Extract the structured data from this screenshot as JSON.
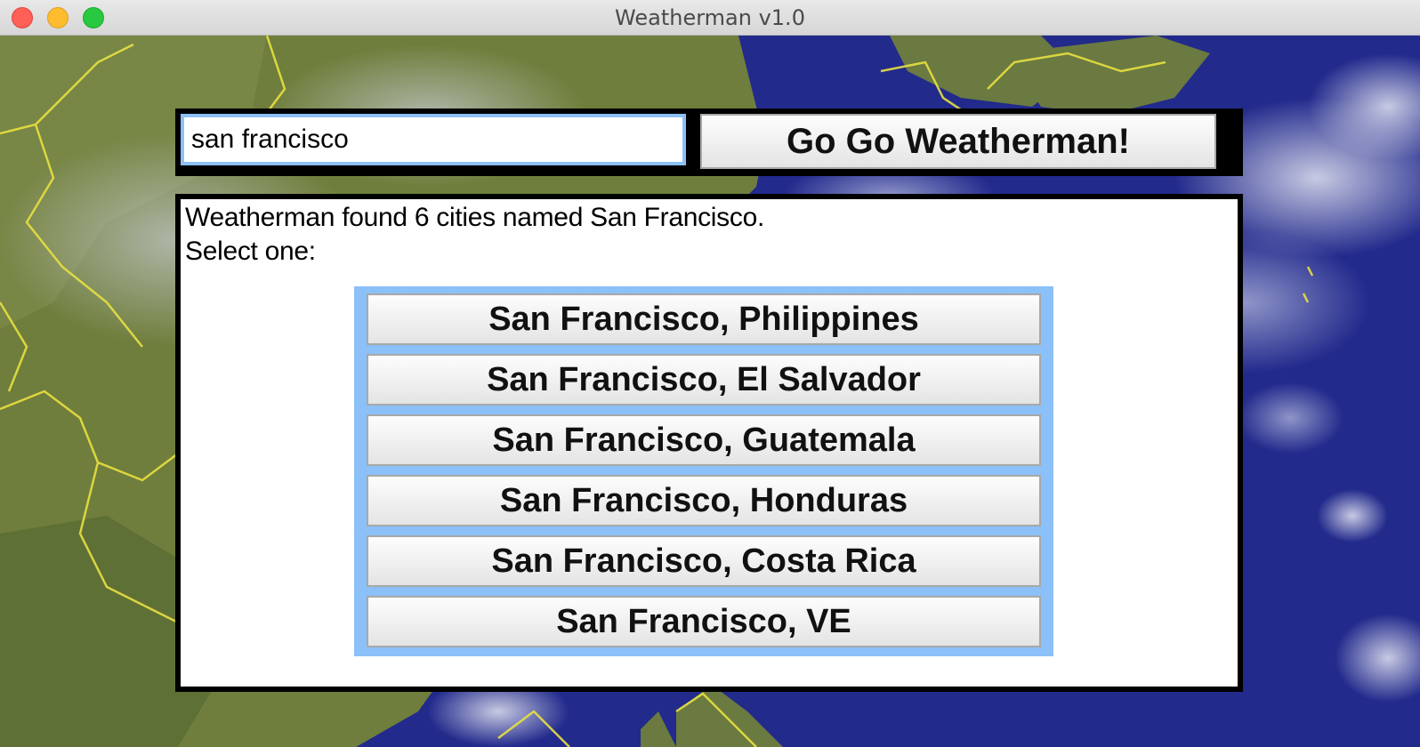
{
  "window": {
    "title": "Weatherman v1.0"
  },
  "search": {
    "value": "san francisco",
    "button_label": "Go Go Weatherman!"
  },
  "results": {
    "message_line1": "Weatherman found 6 cities named San Francisco.",
    "message_line2": "Select one:",
    "cities": [
      "San Francisco, Philippines",
      "San Francisco, El Salvador",
      "San Francisco, Guatemala",
      "San Francisco, Honduras",
      "San Francisco, Costa Rica",
      "San Francisco, VE"
    ]
  },
  "colors": {
    "input_border": "#8cc0f8",
    "list_background": "#8cc0f8",
    "ocean": "#20288a",
    "land": "#6f7e3c",
    "borders": "#e8e040"
  },
  "icons": {
    "close": "close-icon",
    "minimize": "minimize-icon",
    "zoom": "zoom-icon"
  }
}
